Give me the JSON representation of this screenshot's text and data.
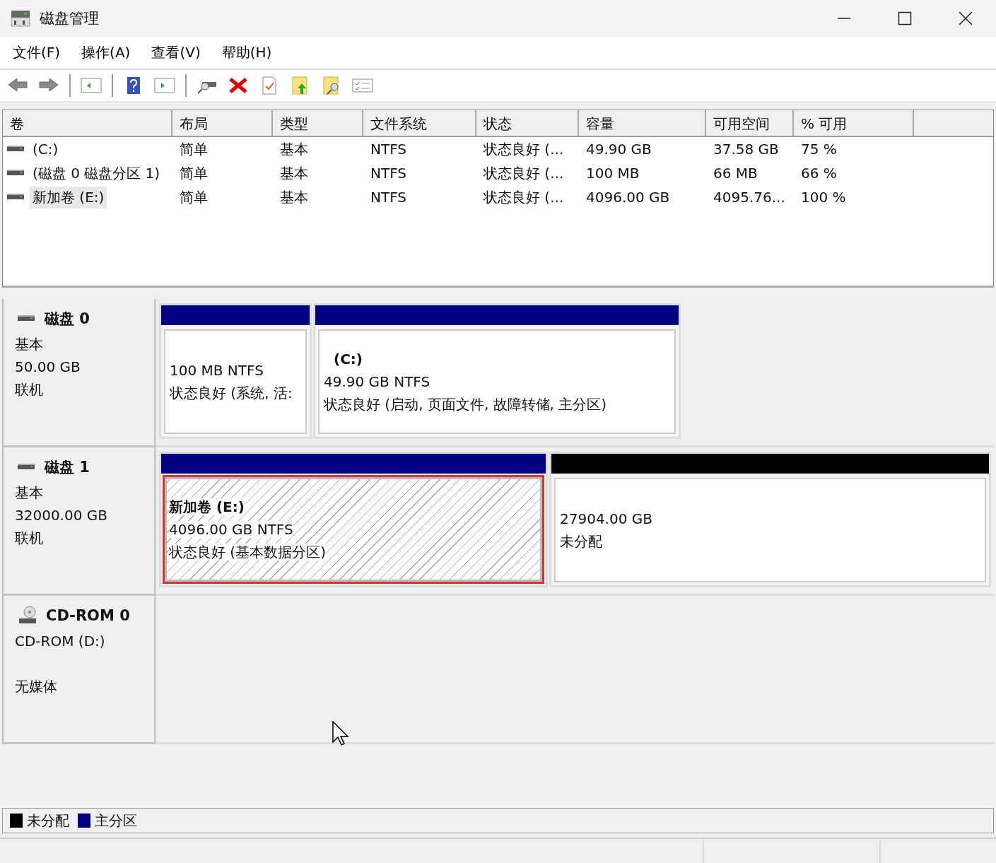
{
  "window": {
    "title": "磁盘管理"
  },
  "menu": [
    "文件(F)",
    "操作(A)",
    "查看(V)",
    "帮助(H)"
  ],
  "volume_table": {
    "columns": [
      "卷",
      "布局",
      "类型",
      "文件系统",
      "状态",
      "容量",
      "可用空间",
      "% 可用"
    ],
    "rows": [
      {
        "cells": [
          "(C:)",
          "简单",
          "基本",
          "NTFS",
          "状态良好 (...",
          "49.90 GB",
          "37.58 GB",
          "75 %"
        ],
        "selected": false
      },
      {
        "cells": [
          "(磁盘 0 磁盘分区 1)",
          "简单",
          "基本",
          "NTFS",
          "状态良好 (...",
          "100 MB",
          "66 MB",
          "66 %"
        ],
        "selected": false
      },
      {
        "cells": [
          "新加卷 (E:)",
          "简单",
          "基本",
          "NTFS",
          "状态良好 (...",
          "4096.00 GB",
          "4095.76...",
          "100 %"
        ],
        "selected": true
      }
    ]
  },
  "disks": [
    {
      "kind": "disk",
      "name": "磁盘 0",
      "lines": [
        "基本",
        "50.00 GB",
        "联机"
      ],
      "partitions": [
        {
          "kind": "primary",
          "size": "100 MB NTFS",
          "status": "状态良好 (系统, 活:",
          "selected": false
        },
        {
          "kind": "primary",
          "title": "(C:)",
          "size": "49.90 GB NTFS",
          "status": "状态良好 (启动, 页面文件, 故障转储, 主分区)",
          "selected": false
        }
      ]
    },
    {
      "kind": "disk",
      "name": "磁盘 1",
      "lines": [
        "基本",
        "32000.00 GB",
        "联机"
      ],
      "partitions": [
        {
          "kind": "primary",
          "title": "新加卷  (E:)",
          "size": "4096.00 GB NTFS",
          "status": "状态良好 (基本数据分区)",
          "selected": true
        },
        {
          "kind": "unallocated",
          "size": "27904.00 GB",
          "status": "未分配",
          "selected": false
        }
      ]
    },
    {
      "kind": "cdrom",
      "name": "CD-ROM 0",
      "lines": [
        "CD-ROM (D:)",
        "无媒体"
      ]
    }
  ],
  "legend": [
    {
      "label": "未分配",
      "color": "#000000"
    },
    {
      "label": "主分区",
      "color": "#000080"
    }
  ]
}
